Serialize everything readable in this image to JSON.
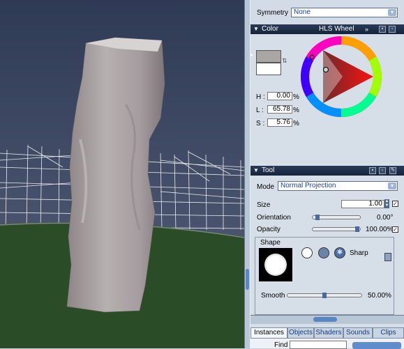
{
  "symmetry": {
    "label": "Symmetry",
    "value": "None"
  },
  "color_panel": {
    "title": "Color",
    "mode": "HLS Wheel",
    "h_label": "H :",
    "h_value": "0.00",
    "h_unit": "%",
    "l_label": "L :",
    "l_value": "65.78",
    "l_unit": "%",
    "s_label": "S :",
    "s_value": "5.76",
    "s_unit": "%",
    "colors": {
      "foreground": "#aaa6a6",
      "background": "#ffffff"
    }
  },
  "tool_panel": {
    "title": "Tool",
    "mode_label": "Mode",
    "mode_value": "Normal Projection",
    "size_label": "Size",
    "size_value": "1.00",
    "orientation_label": "Orientation",
    "orientation_value": "0.00°",
    "opacity_label": "Opacity",
    "opacity_value": "100.00%",
    "shape_label": "Shape",
    "sharp_label": "Sharp",
    "smooth_label": "Smooth",
    "smooth_value": "50.00%"
  },
  "tabs": [
    {
      "label": "Instances"
    },
    {
      "label": "Objects"
    },
    {
      "label": "Shaders"
    },
    {
      "label": "Sounds"
    },
    {
      "label": "Clips"
    }
  ],
  "bottom": {
    "find_label": "Find"
  }
}
